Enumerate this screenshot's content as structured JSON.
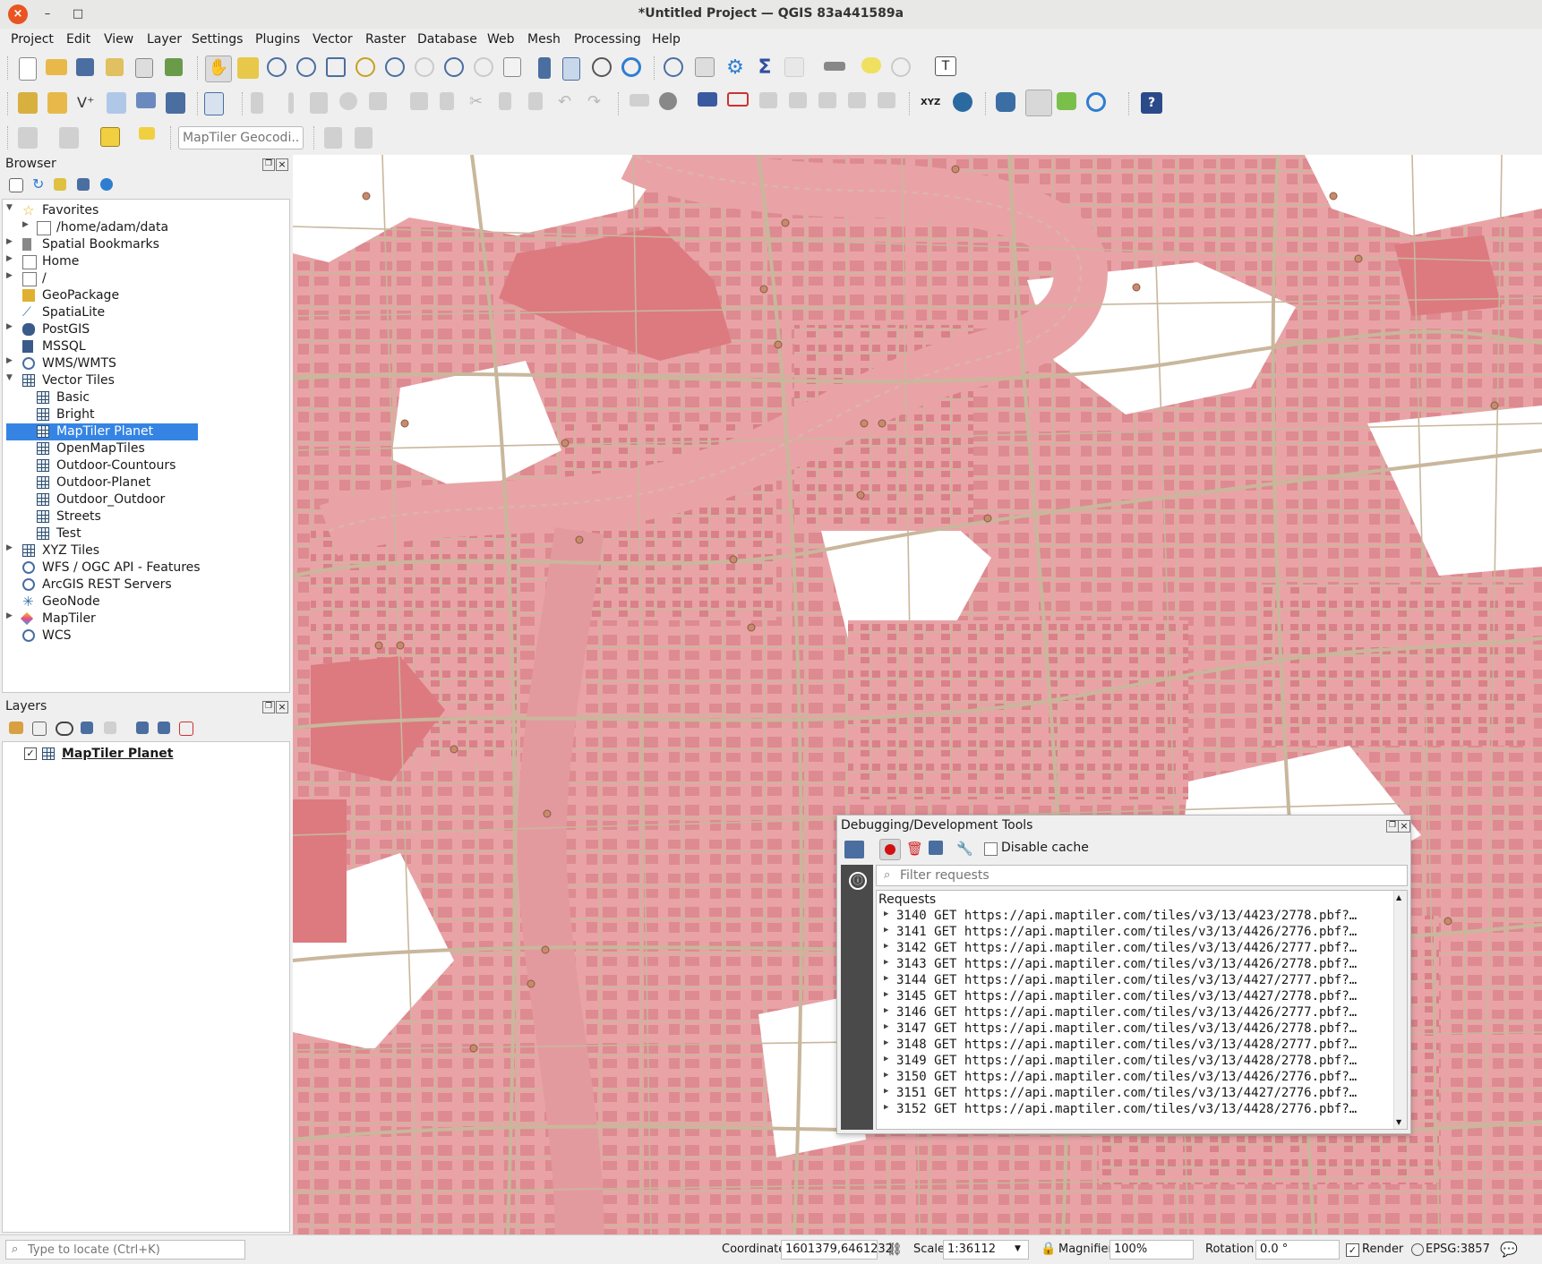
{
  "window": {
    "title": "*Untitled Project — QGIS 83a441589a",
    "close_glyph": "×",
    "min_glyph": "–",
    "max_glyph": "□"
  },
  "menu": [
    "Project",
    "Edit",
    "View",
    "Layer",
    "Settings",
    "Plugins",
    "Vector",
    "Raster",
    "Database",
    "Web",
    "Mesh",
    "Processing",
    "Help"
  ],
  "toolbar3": {
    "geocoder_placeholder": "MapTiler Geocodi..."
  },
  "browser": {
    "title": "Browser",
    "items": [
      {
        "label": "Favorites",
        "icon": "star-icon",
        "expanded": true,
        "indent": 0
      },
      {
        "label": "/home/adam/data",
        "icon": "folder-icon",
        "expanded": false,
        "indent": 1
      },
      {
        "label": "Spatial Bookmarks",
        "icon": "bookmark-icon",
        "expanded": false,
        "indent": 0
      },
      {
        "label": "Home",
        "icon": "home-folder-icon",
        "expanded": false,
        "indent": 0
      },
      {
        "label": "/",
        "icon": "folder-icon",
        "expanded": false,
        "indent": 0
      },
      {
        "label": "GeoPackage",
        "icon": "geopackage-icon",
        "expanded": null,
        "indent": 0
      },
      {
        "label": "SpatiaLite",
        "icon": "spatialite-icon",
        "expanded": null,
        "indent": 0
      },
      {
        "label": "PostGIS",
        "icon": "postgis-icon",
        "expanded": false,
        "indent": 0
      },
      {
        "label": "MSSQL",
        "icon": "mssql-icon",
        "expanded": null,
        "indent": 0
      },
      {
        "label": "WMS/WMTS",
        "icon": "globe-icon",
        "expanded": false,
        "indent": 0
      },
      {
        "label": "Vector Tiles",
        "icon": "vector-tiles-icon",
        "expanded": true,
        "indent": 0
      },
      {
        "label": "Basic",
        "icon": "vector-tiles-icon",
        "expanded": null,
        "indent": 1
      },
      {
        "label": "Bright",
        "icon": "vector-tiles-icon",
        "expanded": null,
        "indent": 1
      },
      {
        "label": "MapTiler Planet",
        "icon": "vector-tiles-icon",
        "expanded": null,
        "indent": 1,
        "selected": true
      },
      {
        "label": "OpenMapTiles",
        "icon": "vector-tiles-icon",
        "expanded": null,
        "indent": 1
      },
      {
        "label": "Outdoor-Countours",
        "icon": "vector-tiles-icon",
        "expanded": null,
        "indent": 1
      },
      {
        "label": "Outdoor-Planet",
        "icon": "vector-tiles-icon",
        "expanded": null,
        "indent": 1
      },
      {
        "label": "Outdoor_Outdoor",
        "icon": "vector-tiles-icon",
        "expanded": null,
        "indent": 1
      },
      {
        "label": "Streets",
        "icon": "vector-tiles-icon",
        "expanded": null,
        "indent": 1
      },
      {
        "label": "Test",
        "icon": "vector-tiles-icon",
        "expanded": null,
        "indent": 1
      },
      {
        "label": "XYZ Tiles",
        "icon": "vector-tiles-icon",
        "expanded": false,
        "indent": 0
      },
      {
        "label": "WFS / OGC API - Features",
        "icon": "globe-icon",
        "expanded": null,
        "indent": 0
      },
      {
        "label": "ArcGIS REST Servers",
        "icon": "globe-icon",
        "expanded": null,
        "indent": 0
      },
      {
        "label": "GeoNode",
        "icon": "geonode-icon",
        "expanded": null,
        "indent": 0
      },
      {
        "label": "MapTiler",
        "icon": "maptiler-icon",
        "expanded": false,
        "indent": 0
      },
      {
        "label": "WCS",
        "icon": "globe-icon",
        "expanded": null,
        "indent": 0
      }
    ]
  },
  "layers": {
    "title": "Layers",
    "items": [
      {
        "label": "MapTiler Planet",
        "checked": true
      }
    ]
  },
  "debug": {
    "title": "Debugging/Development Tools",
    "disable_cache_label": "Disable cache",
    "filter_placeholder": "Filter requests",
    "requests_header": "Requests",
    "requests": [
      {
        "id": "3140",
        "method": "GET",
        "url": "https://api.maptiler.com/tiles/v3/13/4423/2778.pbf?…"
      },
      {
        "id": "3141",
        "method": "GET",
        "url": "https://api.maptiler.com/tiles/v3/13/4426/2776.pbf?…"
      },
      {
        "id": "3142",
        "method": "GET",
        "url": "https://api.maptiler.com/tiles/v3/13/4426/2777.pbf?…"
      },
      {
        "id": "3143",
        "method": "GET",
        "url": "https://api.maptiler.com/tiles/v3/13/4426/2778.pbf?…"
      },
      {
        "id": "3144",
        "method": "GET",
        "url": "https://api.maptiler.com/tiles/v3/13/4427/2777.pbf?…"
      },
      {
        "id": "3145",
        "method": "GET",
        "url": "https://api.maptiler.com/tiles/v3/13/4427/2778.pbf?…"
      },
      {
        "id": "3146",
        "method": "GET",
        "url": "https://api.maptiler.com/tiles/v3/13/4426/2777.pbf?…"
      },
      {
        "id": "3147",
        "method": "GET",
        "url": "https://api.maptiler.com/tiles/v3/13/4426/2778.pbf?…"
      },
      {
        "id": "3148",
        "method": "GET",
        "url": "https://api.maptiler.com/tiles/v3/13/4428/2777.pbf?…"
      },
      {
        "id": "3149",
        "method": "GET",
        "url": "https://api.maptiler.com/tiles/v3/13/4428/2778.pbf?…"
      },
      {
        "id": "3150",
        "method": "GET",
        "url": "https://api.maptiler.com/tiles/v3/13/4426/2776.pbf?…"
      },
      {
        "id": "3151",
        "method": "GET",
        "url": "https://api.maptiler.com/tiles/v3/13/4427/2776.pbf?…"
      },
      {
        "id": "3152",
        "method": "GET",
        "url": "https://api.maptiler.com/tiles/v3/13/4428/2776.pbf?…"
      }
    ]
  },
  "statusbar": {
    "locate_placeholder": "Type to locate (Ctrl+K)",
    "coordinate_label": "Coordinate",
    "coordinate_value": "1601379,6461232",
    "scale_label": "Scale",
    "scale_value": "1:36112",
    "magnifier_label": "Magnifier",
    "magnifier_value": "100%",
    "rotation_label": "Rotation",
    "rotation_value": "0.0 °",
    "render_label": "Render",
    "crs_label": "EPSG:3857"
  },
  "colors": {
    "map_fill": "#e9a3a7",
    "map_fill_dark": "#dc7a80",
    "road": "#c9b79c",
    "selection": "#3584e4"
  }
}
